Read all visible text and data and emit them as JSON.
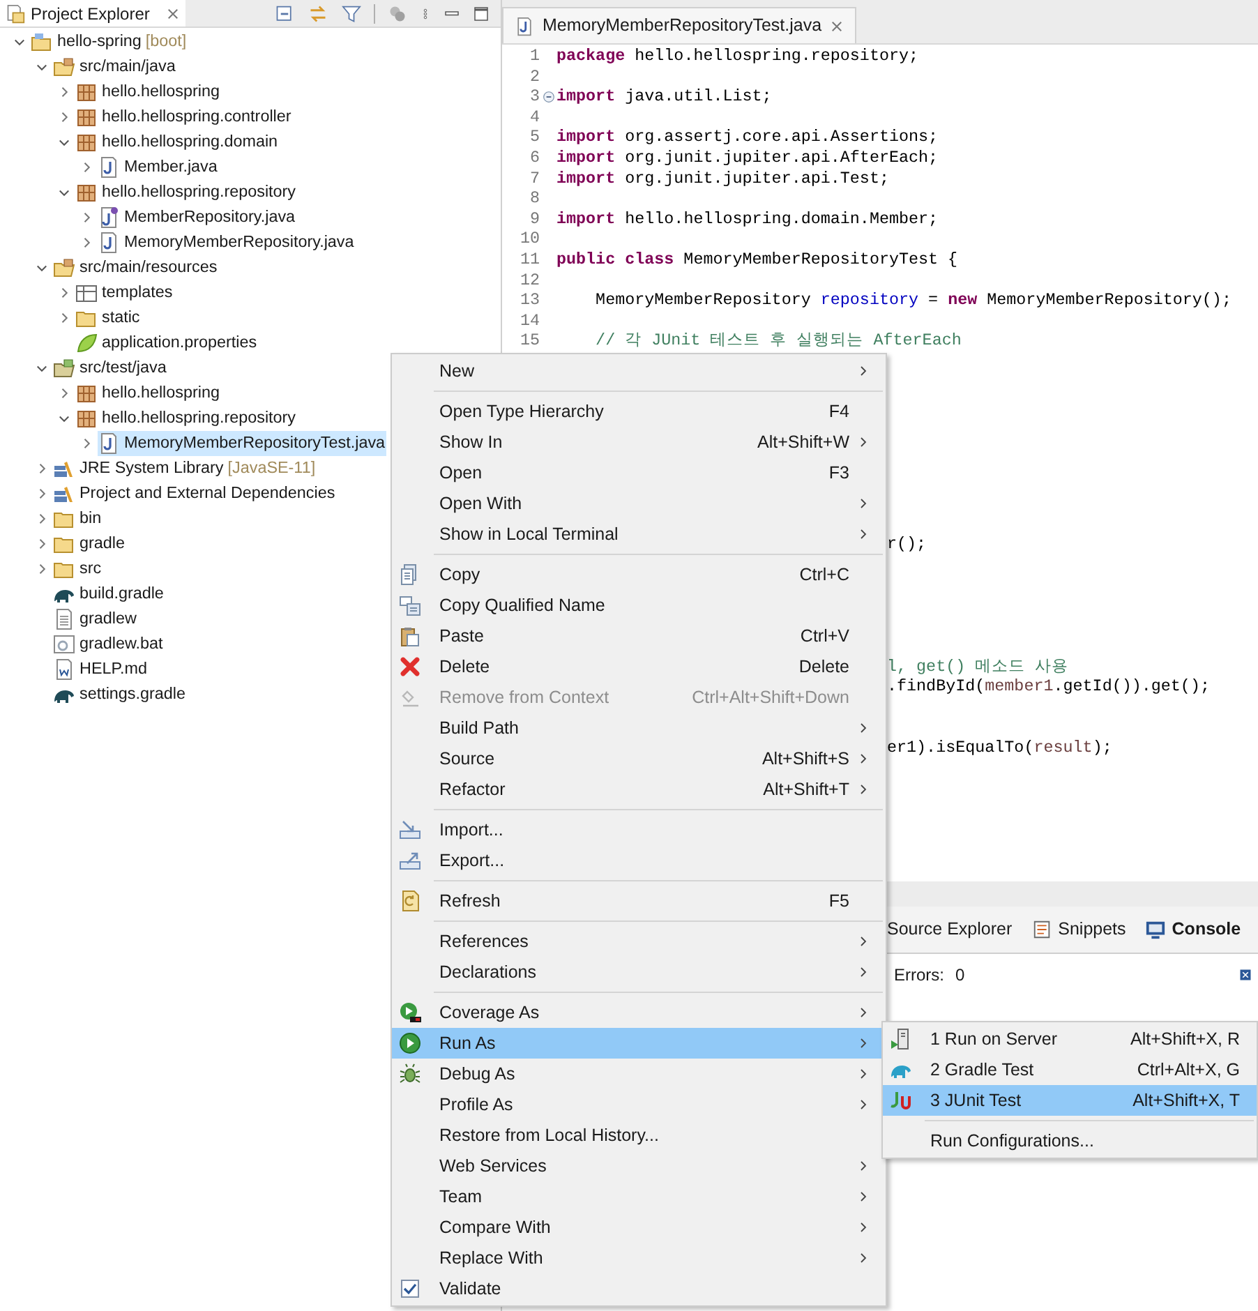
{
  "explorer": {
    "title": "Project Explorer",
    "tree": [
      {
        "label": "hello-spring",
        "suffix": "[boot]",
        "kind": "project",
        "expanded": true,
        "selected": false,
        "children": [
          {
            "label": "src/main/java",
            "kind": "source-folder",
            "expanded": true,
            "selected": false,
            "children": [
              {
                "label": "hello.hellospring",
                "kind": "package",
                "expanded": false,
                "selected": false
              },
              {
                "label": "hello.hellospring.controller",
                "kind": "package",
                "expanded": false,
                "selected": false
              },
              {
                "label": "hello.hellospring.domain",
                "kind": "package",
                "expanded": true,
                "selected": false,
                "children": [
                  {
                    "label": "Member.java",
                    "kind": "java",
                    "expanded": false,
                    "selected": false
                  }
                ]
              },
              {
                "label": "hello.hellospring.repository",
                "kind": "package",
                "expanded": true,
                "selected": false,
                "children": [
                  {
                    "label": "MemberRepository.java",
                    "kind": "interface",
                    "expanded": false,
                    "selected": false
                  },
                  {
                    "label": "MemoryMemberRepository.java",
                    "kind": "java",
                    "expanded": false,
                    "selected": false
                  }
                ]
              }
            ]
          },
          {
            "label": "src/main/resources",
            "kind": "source-folder",
            "expanded": true,
            "selected": false,
            "children": [
              {
                "label": "templates",
                "kind": "templates",
                "expanded": false,
                "selected": false
              },
              {
                "label": "static",
                "kind": "folder",
                "expanded": false,
                "selected": false
              },
              {
                "label": "application.properties",
                "kind": "properties",
                "selected": false
              }
            ]
          },
          {
            "label": "src/test/java",
            "kind": "test-folder",
            "expanded": true,
            "selected": false,
            "children": [
              {
                "label": "hello.hellospring",
                "kind": "package",
                "expanded": false,
                "selected": false
              },
              {
                "label": "hello.hellospring.repository",
                "kind": "package",
                "expanded": true,
                "selected": false,
                "children": [
                  {
                    "label": "MemoryMemberRepositoryTest.java",
                    "kind": "java",
                    "expanded": false,
                    "selected": true
                  }
                ]
              }
            ]
          },
          {
            "label": "JRE System Library",
            "suffix": "[JavaSE-11]",
            "kind": "library",
            "expanded": false,
            "selected": false
          },
          {
            "label": "Project and External Dependencies",
            "kind": "library",
            "expanded": false,
            "selected": false
          },
          {
            "label": "bin",
            "kind": "folder",
            "expanded": false,
            "selected": false
          },
          {
            "label": "gradle",
            "kind": "folder",
            "expanded": false,
            "selected": false
          },
          {
            "label": "src",
            "kind": "folder",
            "expanded": false,
            "selected": false
          },
          {
            "label": "build.gradle",
            "kind": "gradle",
            "selected": false
          },
          {
            "label": "gradlew",
            "kind": "file",
            "selected": false
          },
          {
            "label": "gradlew.bat",
            "kind": "bat",
            "selected": false
          },
          {
            "label": "HELP.md",
            "kind": "md",
            "selected": false
          },
          {
            "label": "settings.gradle",
            "kind": "gradle",
            "selected": false
          }
        ]
      }
    ]
  },
  "editor": {
    "tab": "MemoryMemberRepositoryTest.java",
    "lines": [
      {
        "number": "1",
        "fold": false,
        "code": [
          {
            "kind": "keyword",
            "text": "package"
          },
          {
            "kind": "plain",
            "text": " hello.hellospring.repository;"
          }
        ]
      },
      {
        "number": "2",
        "fold": false
      },
      {
        "number": "3",
        "fold": true,
        "code": [
          {
            "kind": "keyword",
            "text": "import"
          },
          {
            "kind": "plain",
            "text": " java.util.List;"
          }
        ]
      },
      {
        "number": "4",
        "fold": false
      },
      {
        "number": "5",
        "fold": false,
        "code": [
          {
            "kind": "keyword",
            "text": "import"
          },
          {
            "kind": "plain",
            "text": " org.assertj.core.api.Assertions;"
          }
        ]
      },
      {
        "number": "6",
        "fold": false,
        "code": [
          {
            "kind": "keyword",
            "text": "import"
          },
          {
            "kind": "plain",
            "text": " org.junit.jupiter.api.AfterEach;"
          }
        ]
      },
      {
        "number": "7",
        "fold": false,
        "code": [
          {
            "kind": "keyword",
            "text": "import"
          },
          {
            "kind": "plain",
            "text": " org.junit.jupiter.api.Test;"
          }
        ]
      },
      {
        "number": "8",
        "fold": false
      },
      {
        "number": "9",
        "fold": false,
        "code": [
          {
            "kind": "keyword",
            "text": "import"
          },
          {
            "kind": "plain",
            "text": " hello.hellospring.domain.Member;"
          }
        ]
      },
      {
        "number": "10",
        "fold": false
      },
      {
        "number": "11",
        "fold": false,
        "code": [
          {
            "kind": "keyword",
            "text": "public class"
          },
          {
            "kind": "plain",
            "text": " MemoryMemberRepositoryTest {"
          }
        ]
      },
      {
        "number": "12",
        "fold": false
      },
      {
        "number": "13",
        "fold": false,
        "code": [
          {
            "kind": "plain",
            "text": "    MemoryMemberRepository "
          },
          {
            "kind": "field",
            "text": "repository"
          },
          {
            "kind": "plain",
            "text": " = "
          },
          {
            "kind": "keyword",
            "text": "new"
          },
          {
            "kind": "plain",
            "text": " MemoryMemberRepository();"
          }
        ]
      },
      {
        "number": "14",
        "fold": false
      },
      {
        "number": "15",
        "fold": false,
        "code": [
          {
            "kind": "comment",
            "text": "    // 각 JUnit 테스트 후 실행되는 AfterEach"
          }
        ]
      }
    ],
    "fragments": [
      {
        "code": [
          {
            "kind": "plain",
            "text": "r();"
          }
        ]
      },
      {
        "code": [
          {
            "kind": "comment",
            "text": "l, get() 메소드 사용"
          }
        ]
      },
      {
        "code": [
          {
            "kind": "plain",
            "text": ".findById("
          },
          {
            "kind": "variable",
            "text": "member1"
          },
          {
            "kind": "plain",
            "text": ".getId()).get();"
          }
        ]
      },
      {
        "code": [
          {
            "kind": "plain",
            "text": "er1).isEqualTo("
          },
          {
            "kind": "variable",
            "text": "result"
          },
          {
            "kind": "plain",
            "text": ");"
          }
        ]
      }
    ]
  },
  "bottom_panel": {
    "tabs": [
      {
        "label": "Source Explorer",
        "kind": "plain",
        "selected": false
      },
      {
        "label": "Snippets",
        "kind": "snippets",
        "selected": false
      },
      {
        "label": "Console",
        "kind": "console",
        "selected": true
      }
    ],
    "errors_label": "Errors:",
    "errors_count": "0"
  },
  "context_menu": [
    {
      "kind": "plain",
      "label": "New",
      "submenu": true,
      "disabled": false,
      "selected": false
    },
    {
      "kind": "separator"
    },
    {
      "kind": "plain",
      "label": "Open Type Hierarchy",
      "shortcut": "F4",
      "submenu": false,
      "disabled": false,
      "selected": false
    },
    {
      "kind": "plain",
      "label": "Show In",
      "shortcut": "Alt+Shift+W",
      "submenu": true,
      "disabled": false,
      "selected": false
    },
    {
      "kind": "plain",
      "label": "Open",
      "shortcut": "F3",
      "submenu": false,
      "disabled": false,
      "selected": false
    },
    {
      "kind": "plain",
      "label": "Open With",
      "submenu": true,
      "disabled": false,
      "selected": false
    },
    {
      "kind": "plain",
      "label": "Show in Local Terminal",
      "submenu": true,
      "disabled": false,
      "selected": false
    },
    {
      "kind": "separator"
    },
    {
      "kind": "copy",
      "label": "Copy",
      "shortcut": "Ctrl+C",
      "submenu": false,
      "disabled": false,
      "selected": false
    },
    {
      "kind": "copy-name",
      "label": "Copy Qualified Name",
      "submenu": false,
      "disabled": false,
      "selected": false
    },
    {
      "kind": "paste",
      "label": "Paste",
      "shortcut": "Ctrl+V",
      "submenu": false,
      "disabled": false,
      "selected": false
    },
    {
      "kind": "delete",
      "label": "Delete",
      "shortcut": "Delete",
      "submenu": false,
      "disabled": false,
      "selected": false
    },
    {
      "kind": "remove",
      "label": "Remove from Context",
      "shortcut": "Ctrl+Alt+Shift+Down",
      "submenu": false,
      "disabled": true,
      "selected": false
    },
    {
      "kind": "plain",
      "label": "Build Path",
      "submenu": true,
      "disabled": false,
      "selected": false
    },
    {
      "kind": "plain",
      "label": "Source",
      "shortcut": "Alt+Shift+S",
      "submenu": true,
      "disabled": false,
      "selected": false
    },
    {
      "kind": "plain",
      "label": "Refactor",
      "shortcut": "Alt+Shift+T",
      "submenu": true,
      "disabled": false,
      "selected": false
    },
    {
      "kind": "separator"
    },
    {
      "kind": "import",
      "label": "Import...",
      "submenu": false,
      "disabled": false,
      "selected": false
    },
    {
      "kind": "export",
      "label": "Export...",
      "submenu": false,
      "disabled": false,
      "selected": false
    },
    {
      "kind": "separator"
    },
    {
      "kind": "refresh",
      "label": "Refresh",
      "shortcut": "F5",
      "submenu": false,
      "disabled": false,
      "selected": false
    },
    {
      "kind": "separator"
    },
    {
      "kind": "plain",
      "label": "References",
      "submenu": true,
      "disabled": false,
      "selected": false
    },
    {
      "kind": "plain",
      "label": "Declarations",
      "submenu": true,
      "disabled": false,
      "selected": false
    },
    {
      "kind": "separator"
    },
    {
      "kind": "coverage",
      "label": "Coverage As",
      "submenu": true,
      "disabled": false,
      "selected": false
    },
    {
      "kind": "run",
      "label": "Run As",
      "submenu": true,
      "disabled": false,
      "selected": true
    },
    {
      "kind": "debug",
      "label": "Debug As",
      "submenu": true,
      "disabled": false,
      "selected": false
    },
    {
      "kind": "plain",
      "label": "Profile As",
      "submenu": true,
      "disabled": false,
      "selected": false
    },
    {
      "kind": "plain",
      "label": "Restore from Local History...",
      "submenu": false,
      "disabled": false,
      "selected": false
    },
    {
      "kind": "plain",
      "label": "Web Services",
      "submenu": true,
      "disabled": false,
      "selected": false
    },
    {
      "kind": "plain",
      "label": "Team",
      "submenu": true,
      "disabled": false,
      "selected": false
    },
    {
      "kind": "plain",
      "label": "Compare With",
      "submenu": true,
      "disabled": false,
      "selected": false
    },
    {
      "kind": "plain",
      "label": "Replace With",
      "submenu": true,
      "disabled": false,
      "selected": false
    },
    {
      "kind": "validate",
      "label": "Validate",
      "submenu": false,
      "disabled": false,
      "selected": false
    }
  ],
  "run_as_submenu": [
    {
      "kind": "server",
      "label": "1 Run on Server",
      "shortcut": "Alt+Shift+X, R",
      "selected": false
    },
    {
      "kind": "gradle",
      "label": "2 Gradle Test",
      "shortcut": "Ctrl+Alt+X, G",
      "selected": false
    },
    {
      "kind": "junit",
      "label": "3 JUnit Test",
      "shortcut": "Alt+Shift+X, T",
      "selected": true
    },
    {
      "kind": "separator"
    },
    {
      "kind": "plain",
      "label": "Run Configurations...",
      "selected": false
    }
  ]
}
